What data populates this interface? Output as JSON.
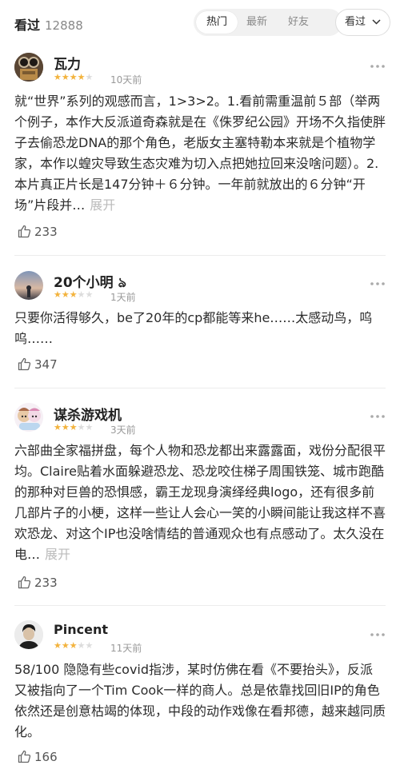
{
  "header": {
    "title": "看过",
    "count": "12888",
    "tabs": [
      "热门",
      "最新",
      "好友"
    ],
    "active_tab": "热门",
    "filter_label": "看过"
  },
  "comments": [
    {
      "user": "瓦力",
      "rating_stars": 4,
      "time": "10天前",
      "text": "就“世界”系列的观感而言，1>3>2。1.看前需重温前５部（举两个例子，本作大反派道奇森就是在《侏罗纪公园》开场不久指使胖子去偷恐龙DNA的那个角色，老版女主塞特勒本来就是个植物学家，本作以蝗灾导致生态灾难为切入点把她拉回来没啥问题）。2.本片真正片长是147分钟＋６分钟。一年前就放出的６分钟“开场”片段并…",
      "expand": "展开",
      "likes": "233"
    },
    {
      "user": "20个小明",
      "user_badge": "ঌ",
      "rating_stars": 3,
      "time": "1天前",
      "text": "只要你活得够久，be了20年的cp都能等来he……太感动鸟，呜呜……",
      "likes": "347"
    },
    {
      "user": "谋杀游戏机",
      "rating_stars": 3,
      "time": "3天前",
      "text": "六部曲全家福拼盘，每个人物和恐龙都出来露露面，戏份分配很平均。Claire贴着水面躲避恐龙、恐龙咬住梯子周围铁笼、城市跑酷的那种对巨兽的恐惧感，霸王龙现身演绎经典logo，还有很多前几部片子的小梗，这样一些让人会心一笑的小瞬间能让我这样不喜欢恐龙、对这个IP也没啥情结的普通观众也有点感动了。太久没在电…",
      "expand": "展开",
      "likes": "233"
    },
    {
      "user": "Pincent",
      "rating_stars": 3,
      "time": "11天前",
      "text": "58/100 隐隐有些covid指涉，某时仿佛在看《不要抬头》，反派又被指向了一个Tim Cook一样的商人。总是依靠找回旧IP的角色依然还是创意枯竭的体现，中段的动作戏像在看邦德，越来越同质化。",
      "likes": "166"
    }
  ],
  "colors": {
    "star_on": "#f3b33d",
    "star_off": "#dcdcdc",
    "muted": "#999999",
    "expand": "#bbbbbb"
  }
}
